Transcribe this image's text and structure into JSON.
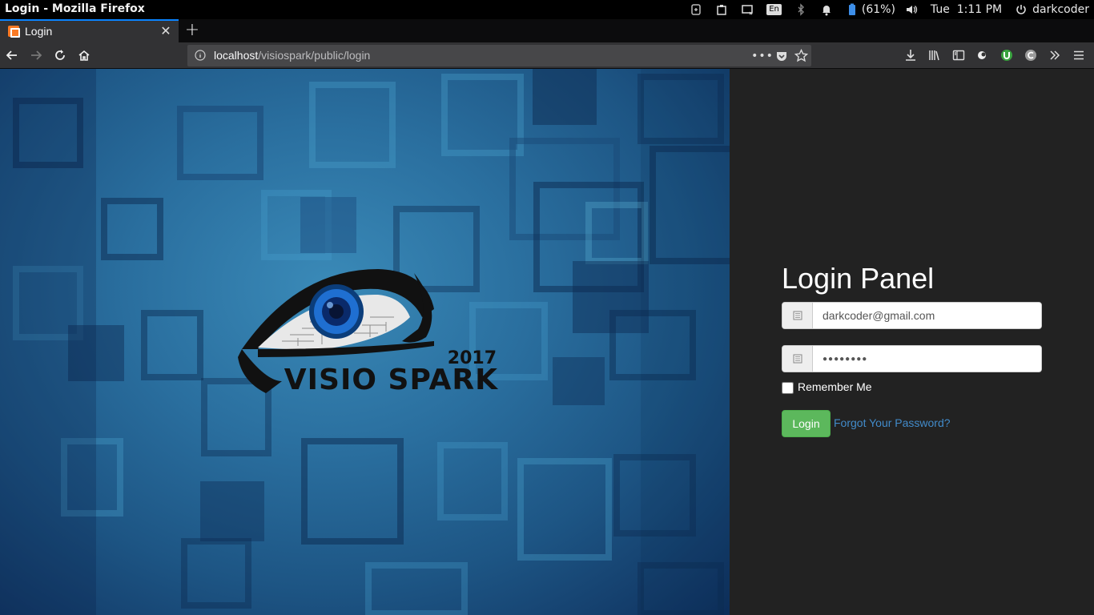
{
  "system_bar": {
    "window_title": "Login - Mozilla Firefox",
    "keyboard_layout": "En",
    "battery": "(61%)",
    "time": "Tue  1:11 PM",
    "user": "darkcoder"
  },
  "browser": {
    "tab_title": "Login",
    "url_host": "localhost",
    "url_path": "/visiospark/public/login",
    "accent": "#0a84ff"
  },
  "hero": {
    "logo_year": "2017",
    "logo_name": "VISIO SPARK"
  },
  "login": {
    "title": "Login Panel",
    "email_value": "darkcoder@gmail.com",
    "password_value": "●●●●●●●●",
    "remember_label": "Remember Me",
    "login_button": "Login",
    "forgot_link": "Forgot Your Password?",
    "button_color": "#5cb85c",
    "link_color": "#428bca"
  }
}
